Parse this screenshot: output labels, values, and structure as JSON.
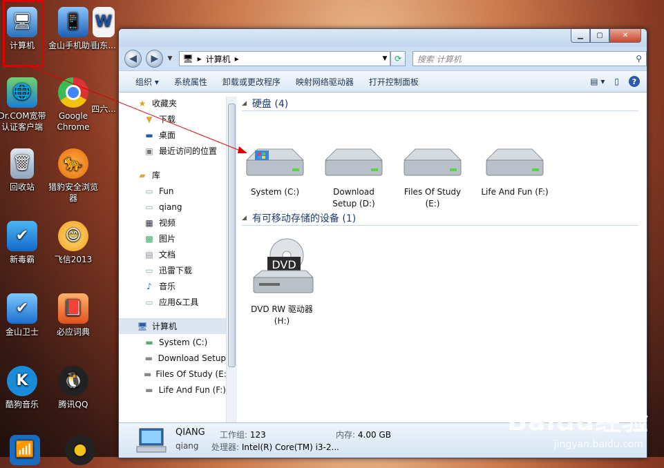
{
  "desktop": {
    "icons": [
      {
        "label": "计算机"
      },
      {
        "label": "金山手机助手"
      },
      {
        "label": "山东..."
      },
      {
        "label": "Dr.COM宽带认证客户端"
      },
      {
        "label": "Google Chrome"
      },
      {
        "label": "四六..."
      },
      {
        "label": "回收站"
      },
      {
        "label": "猎豹安全浏览器"
      },
      {
        "label": "新毒霸"
      },
      {
        "label": "飞信2013"
      },
      {
        "label": "金山卫士"
      },
      {
        "label": "必应词典"
      },
      {
        "label": "酷狗音乐"
      },
      {
        "label": "腾讯QQ"
      }
    ]
  },
  "window": {
    "address": {
      "root_icon": "computer-icon",
      "path": "计算机",
      "sep": "▸"
    },
    "search_placeholder": "搜索 计算机",
    "toolbar": {
      "organize": "组织",
      "system_props": "系统属性",
      "uninstall": "卸载或更改程序",
      "map_drive": "映射网络驱动器",
      "control_panel": "打开控制面板"
    },
    "nav": {
      "favorites": "收藏夹",
      "downloads": "下载",
      "desktop": "桌面",
      "recent": "最近访问的位置",
      "libraries": "库",
      "lib_items": [
        "Fun",
        "qiang",
        "视频",
        "图片",
        "文档",
        "迅雷下载",
        "音乐",
        "应用&工具"
      ],
      "computer": "计算机",
      "drives": [
        "System (C:)",
        "Download Setup",
        "Files Of Study (E:",
        "Life And Fun (F:)"
      ]
    },
    "groups": {
      "hdd_header": "硬盘 (4)",
      "removable_header": "有可移动存储的设备 (1)"
    },
    "hard_drives": [
      {
        "line1": "System (C:)",
        "line2": ""
      },
      {
        "line1": "Download",
        "line2": "Setup (D:)"
      },
      {
        "line1": "Files Of Study",
        "line2": "(E:)"
      },
      {
        "line1": "Life And Fun (F:)",
        "line2": ""
      }
    ],
    "dvd": {
      "line1": "DVD RW 驱动器",
      "line2": "(H:)",
      "badge": "DVD"
    },
    "details": {
      "name": "QIANG",
      "user": "qiang",
      "workgroup_label": "工作组:",
      "workgroup": "123",
      "cpu_label": "处理器:",
      "cpu": "Intel(R) Core(TM) i3-2...",
      "mem_label": "内存:",
      "mem": "4.00 GB"
    }
  },
  "watermark": {
    "brand": "Baidu经验",
    "url": "jingyan.baidu.com"
  }
}
